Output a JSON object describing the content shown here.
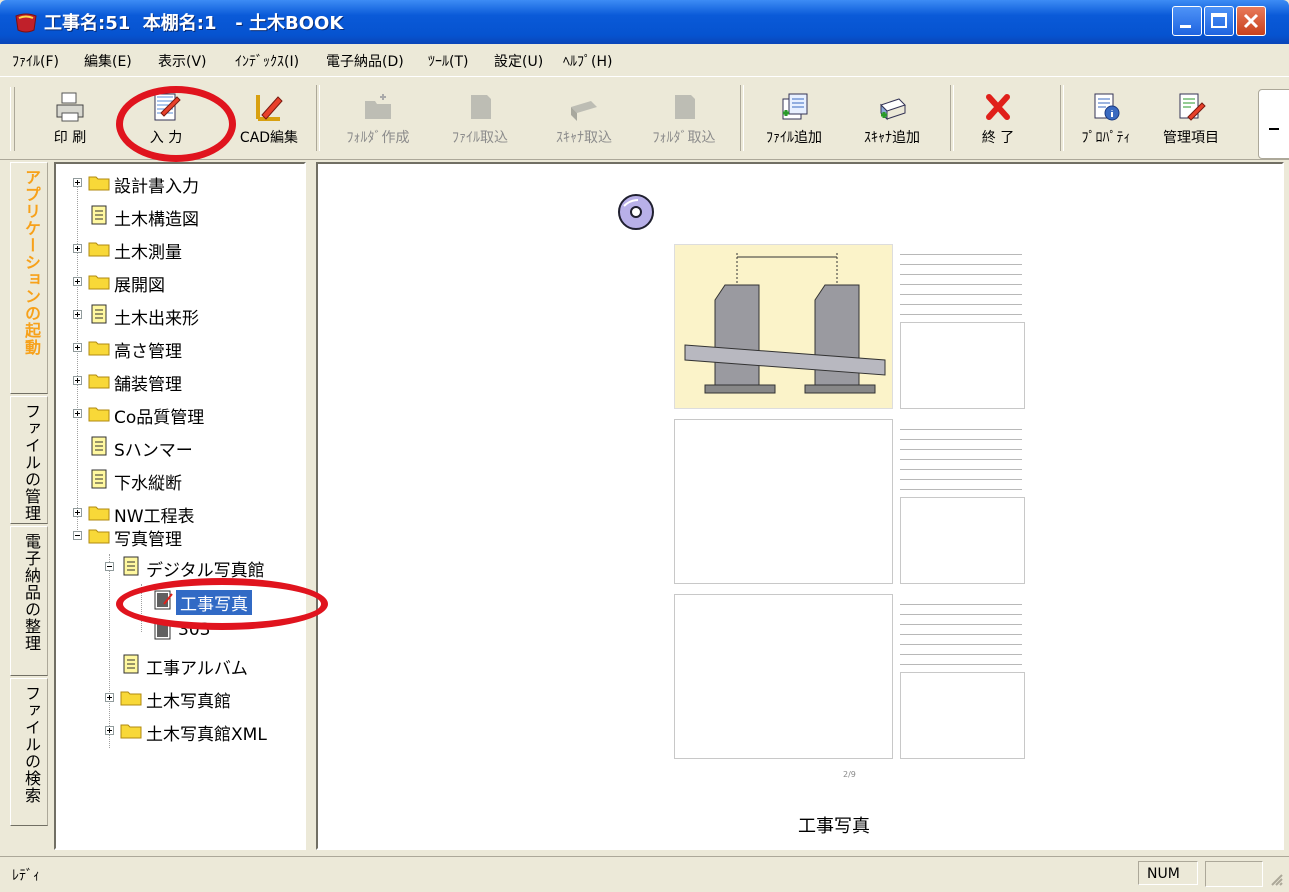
{
  "window": {
    "title": "工事名:51  本棚名:1   - 土木BOOK",
    "colors": {
      "titlebar": "#0a5ad8",
      "selection": "#316ac5",
      "annotation": "#e0141e",
      "active_tab": "#f7a11a"
    }
  },
  "menu": [
    "ﾌｧｲﾙ(F)",
    "編集(E)",
    "表示(V)",
    "ｲﾝﾃﾞｯｸｽ(I)",
    "電子納品(D)",
    "ﾂｰﾙ(T)",
    "設定(U)",
    "ﾍﾙﾌﾟ(H)"
  ],
  "toolbar": {
    "print": "印 刷",
    "input": "入 力",
    "cad_edit": "CAD編集",
    "folder_create": "ﾌｫﾙﾀﾞ作成",
    "file_import": "ﾌｧｲﾙ取込",
    "scanner_import": "ｽｷｬﾅ取込",
    "folder_import": "ﾌｫﾙﾀﾞ取込",
    "file_add": "ﾌｧｲﾙ追加",
    "scanner_add": "ｽｷｬﾅ追加",
    "exit": "終 了",
    "property": "ﾌﾟﾛﾊﾟﾃｨ",
    "manage_items": "管理項目"
  },
  "side_tabs": [
    "アプリケーションの起動",
    "ファイルの管理",
    "電子納品の整理",
    "ファイルの検索"
  ],
  "tree": {
    "items": [
      "設計書入力",
      "土木構造図",
      "土木測量",
      "展開図",
      "土木出来形",
      "高さ管理",
      "舗装管理",
      "Co品質管理",
      "Sハンマー",
      "下水縦断",
      "NW工程表",
      "写真管理",
      "デジタル写真館",
      "工事写真",
      "303",
      "工事アルバム",
      "土木写真館",
      "土木写真館XML"
    ]
  },
  "preview": {
    "page_number": "2/9",
    "caption": "工事写真"
  },
  "status": {
    "text": "ﾚﾃﾞｨ",
    "num": "NUM"
  }
}
